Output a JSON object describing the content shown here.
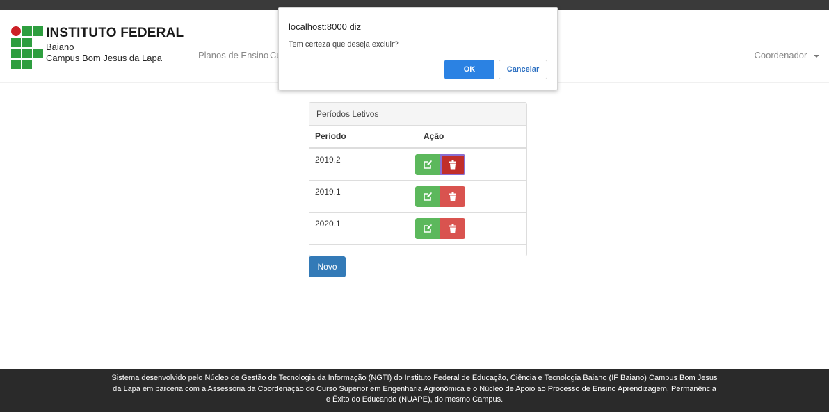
{
  "colors": {
    "topbar": "#3a3a3a",
    "logo_green": "#2e9e3f",
    "logo_red": "#cc2026",
    "edit_green": "#5cb85c",
    "delete_red": "#d9534f",
    "primary_blue": "#337ab7",
    "dialog_ok_blue": "#2b82e3",
    "footer_bg": "#2a2a2a"
  },
  "header": {
    "logo": {
      "title": "INSTITUTO FEDERAL",
      "subtitle1": "Baiano",
      "subtitle2": "Campus Bom Jesus da Lapa"
    },
    "nav_items": [
      {
        "label": "Planos de Ensino"
      },
      {
        "label": "Cu"
      }
    ],
    "user_menu": {
      "label": "Coordenador",
      "icon": "caret-down-icon"
    }
  },
  "dialog": {
    "title": "localhost:8000 diz",
    "message": "Tem certeza que deseja excluir?",
    "ok_label": "OK",
    "cancel_label": "Cancelar"
  },
  "panel": {
    "title": "Períodos Letivos",
    "columns": [
      "Período",
      "Ação"
    ],
    "rows": [
      {
        "period": "2019.2"
      },
      {
        "period": "2019.1"
      },
      {
        "period": "2020.1"
      }
    ],
    "edit_icon": "edit-icon",
    "delete_icon": "trash-icon"
  },
  "new_button_label": "Novo",
  "footer": {
    "line1": "Sistema desenvolvido pelo Núcleo de Gestão de Tecnologia da Informação (NGTI) do Instituto Federal de Educação, Ciência e Tecnologia Baiano (IF Baiano) Campus Bom Jesus",
    "line2": "da Lapa em parceria com a Assessoria da Coordenação do Curso Superior em Engenharia Agronômica e o Núcleo de Apoio ao Processo de Ensino Aprendizagem, Permanência",
    "line3": "e Êxito do Educando (NUAPE), do mesmo Campus."
  }
}
